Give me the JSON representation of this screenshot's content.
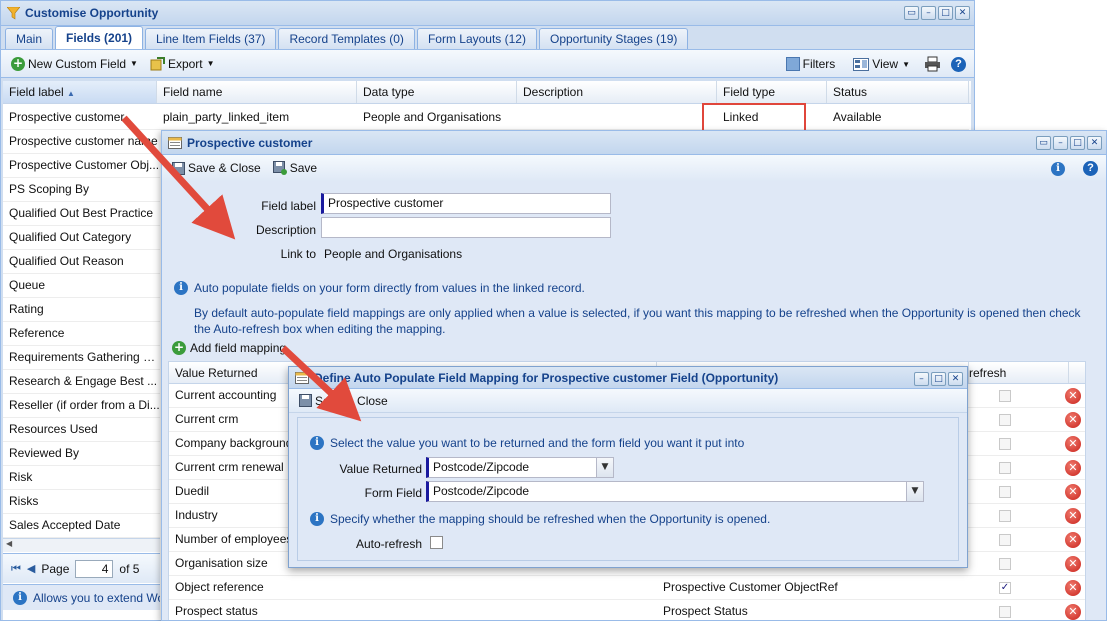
{
  "main_window": {
    "title": "Customise Opportunity",
    "tabs": [
      "Main",
      "Fields (201)",
      "Line Item Fields (37)",
      "Record Templates (0)",
      "Form Layouts (12)",
      "Opportunity Stages (19)"
    ],
    "toolbar": {
      "new_field": "New Custom Field",
      "export": "Export",
      "filters": "Filters",
      "view": "View"
    },
    "grid": {
      "headers": [
        "Field label",
        "Field name",
        "Data type",
        "Description",
        "Field type",
        "Status"
      ],
      "first_row": {
        "label": "Prospective customer",
        "name": "plain_party_linked_item",
        "data_type": "People and Organisations",
        "description": "",
        "field_type": "Linked",
        "status": "Available"
      },
      "labels": [
        "Prospective customer name",
        "Prospective Customer Obj...",
        "PS Scoping By",
        "Qualified Out Best Practice",
        "Qualified Out Category",
        "Qualified Out Reason",
        "Queue",
        "Rating",
        "Reference",
        "Requirements Gathering S...",
        "Research & Engage Best ...",
        "Reseller (if order from a Di...",
        "Resources Used",
        "Reviewed By",
        "Risk",
        "Risks",
        "Sales Accepted Date"
      ]
    },
    "pager": {
      "page_label": "Page",
      "page_value": "4",
      "of_label": "of 5"
    },
    "status_text": "Allows you to extend Worl"
  },
  "field_window": {
    "title": "Prospective customer",
    "toolbar": {
      "save_close": "Save & Close",
      "save": "Save"
    },
    "form": {
      "field_label_label": "Field label",
      "field_label_value": "Prospective customer",
      "description_label": "Description",
      "description_value": "",
      "link_to_label": "Link to",
      "link_to_value": "People and Organisations"
    },
    "info1": "Auto populate fields on your form directly from values in the linked record.",
    "info2": "By default auto-populate field mappings are only applied when a value is selected, if you want this mapping to be refreshed when the Opportunity is opened then check the Auto-refresh box when editing the mapping.",
    "add_mapping": "Add field mapping",
    "mapping_grid": {
      "header_value": "Value Returned",
      "header_refresh": "refresh",
      "rows": [
        {
          "value": "Current accounting",
          "field": "",
          "checked": false
        },
        {
          "value": "Current crm",
          "field": "",
          "checked": false
        },
        {
          "value": "Company background",
          "field": "",
          "checked": false
        },
        {
          "value": "Current crm renewal",
          "field": "",
          "checked": false
        },
        {
          "value": "Duedil",
          "field": "",
          "checked": false
        },
        {
          "value": "Industry",
          "field": "",
          "checked": false
        },
        {
          "value": "Number of employees",
          "field": "",
          "checked": false
        },
        {
          "value": "Organisation size",
          "field": "",
          "checked": false
        },
        {
          "value": "Object reference",
          "field": "Prospective Customer ObjectRef",
          "checked": true
        },
        {
          "value": "Prospect status",
          "field": "Prospect Status",
          "checked": false
        }
      ]
    }
  },
  "mapping_window": {
    "title": "Define Auto Populate Field Mapping for Prospective customer Field (Opportunity)",
    "save_close": "Save & Close",
    "info1": "Select the value you want to be returned and the form field you want it put into",
    "value_returned_label": "Value Returned",
    "value_returned_value": "Postcode/Zipcode",
    "form_field_label": "Form Field",
    "form_field_value": "Postcode/Zipcode",
    "info2": "Specify whether the mapping should be refreshed when the Opportunity is opened.",
    "auto_refresh_label": "Auto-refresh"
  },
  "colors": {
    "title_blue": "#15428b",
    "highlight_red": "#e0463b",
    "panel_blue": "#dfe8f6"
  }
}
